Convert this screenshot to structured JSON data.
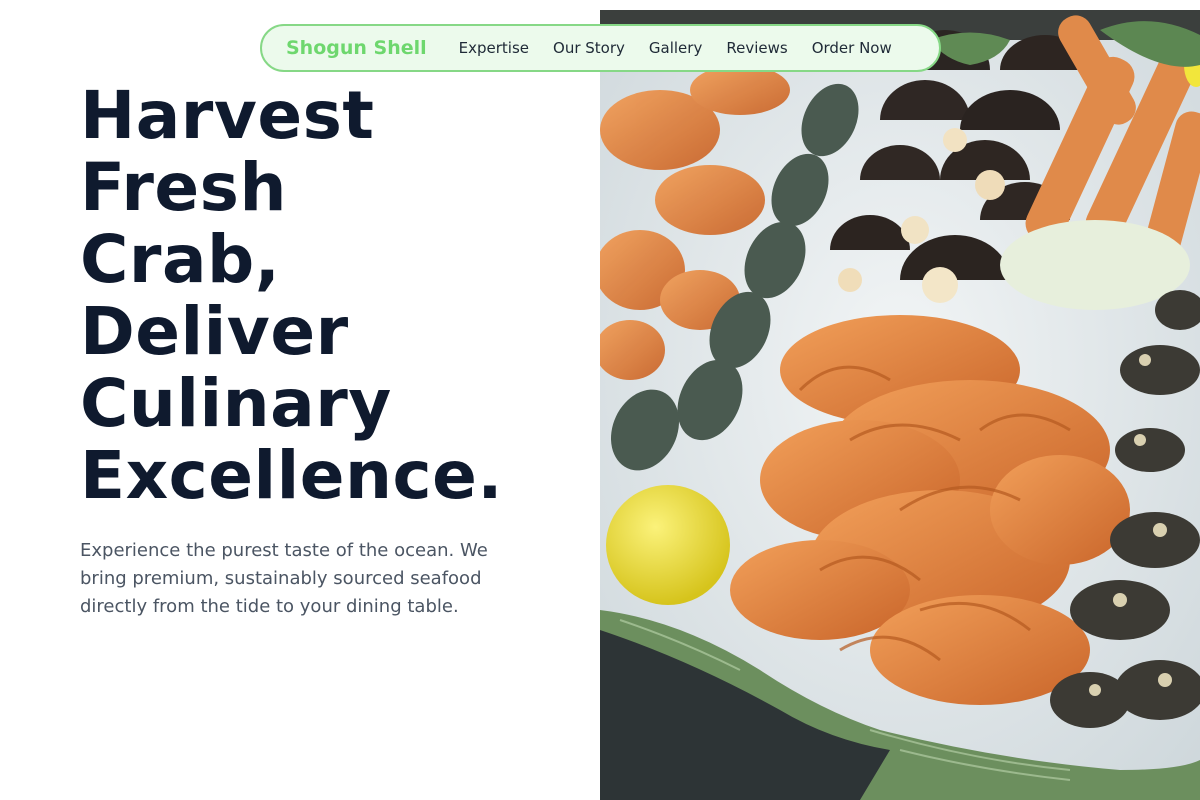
{
  "nav": {
    "brand": "Shogun Shell",
    "links": [
      "Expertise",
      "Our Story",
      "Gallery",
      "Reviews",
      "Order Now"
    ]
  },
  "hero": {
    "headline_lines": [
      "Harvest",
      "Fresh",
      "Crab,",
      "Deliver",
      "Culinary",
      "Excellence."
    ],
    "subcopy": "Experience the purest taste of the ocean. We bring premium, sustainably sourced seafood directly from the tide to your dining table."
  },
  "colors": {
    "brand": "#6ed76e",
    "nav_border": "#86d886",
    "nav_bg": "#ecfaec",
    "headline": "#0f1a2e",
    "body_text": "#4b5563"
  }
}
